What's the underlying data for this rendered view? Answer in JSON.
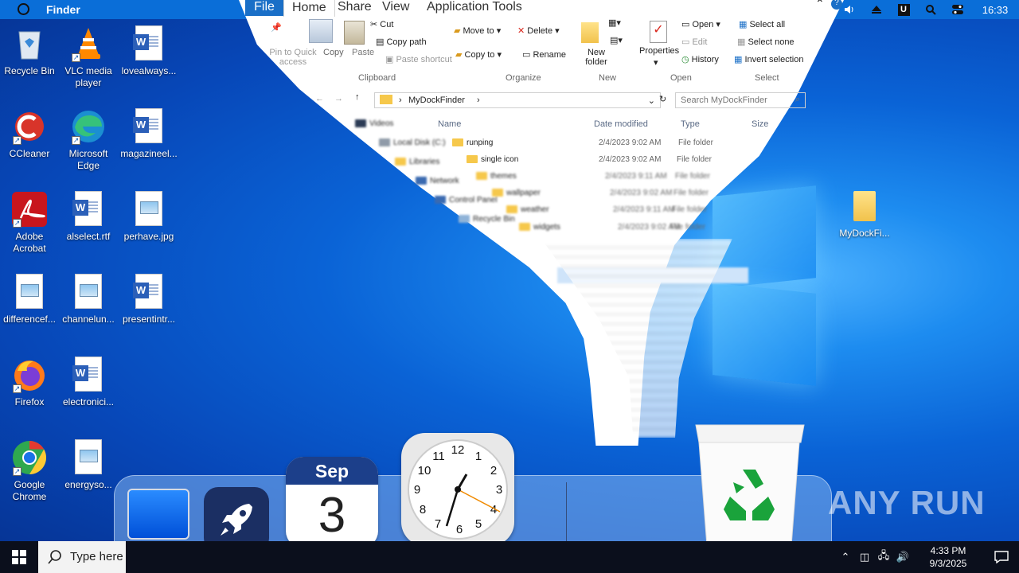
{
  "topbar": {
    "app_name": "Finder",
    "clock": "16:33",
    "u_badge": "U",
    "icons": [
      "apple-circle-icon",
      "volume-icon",
      "eject-icon",
      "u-badge-icon",
      "search-icon",
      "control-center-icon"
    ]
  },
  "desktop_icons": [
    {
      "label": "Recycle Bin",
      "icon": "recycle-bin-icon"
    },
    {
      "label": "VLC media player",
      "icon": "vlc-icon"
    },
    {
      "label": "lovealways...",
      "icon": "word-doc-icon"
    },
    {
      "label": "CCleaner",
      "icon": "ccleaner-icon"
    },
    {
      "label": "Microsoft Edge",
      "icon": "edge-icon"
    },
    {
      "label": "magazineel...",
      "icon": "word-doc-icon"
    },
    {
      "label": "Adobe Acrobat",
      "icon": "acrobat-icon"
    },
    {
      "label": "alselect.rtf",
      "icon": "word-doc-icon"
    },
    {
      "label": "perhave.jpg",
      "icon": "image-file-icon"
    },
    {
      "label": "differencef...",
      "icon": "image-file-icon"
    },
    {
      "label": "channelun...",
      "icon": "image-file-icon"
    },
    {
      "label": "presentintr...",
      "icon": "word-doc-icon"
    },
    {
      "label": "Firefox",
      "icon": "firefox-icon"
    },
    {
      "label": "electronici...",
      "icon": "word-doc-icon"
    },
    {
      "label": "Google Chrome",
      "icon": "chrome-icon"
    },
    {
      "label": "energyso...",
      "icon": "image-file-icon"
    },
    {
      "label": "MyDockFi...",
      "icon": "folder-icon"
    }
  ],
  "explorer": {
    "tabs": [
      "File",
      "Home",
      "Share",
      "View",
      "Application Tools"
    ],
    "clipboard": {
      "pin": "Pin to Quick access",
      "copy": "Copy",
      "paste": "Paste",
      "cut": "Cut",
      "copy_path": "Copy path",
      "paste_shortcut": "Paste shortcut",
      "label": "Clipboard"
    },
    "organize": {
      "move_to": "Move to",
      "copy_to": "Copy to",
      "delete": "Delete",
      "rename": "Rename",
      "label": "Organize"
    },
    "new": {
      "new_folder": "New folder",
      "label": "New"
    },
    "open": {
      "properties": "Properties",
      "open": "Open",
      "edit": "Edit",
      "history": "History",
      "label": "Open"
    },
    "select": {
      "select_all": "Select all",
      "select_none": "Select none",
      "invert": "Invert selection",
      "label": "Select"
    },
    "path": "MyDockFinder",
    "search_placeholder": "Search MyDockFinder",
    "columns": [
      "Name",
      "Date modified",
      "Type",
      "Size"
    ],
    "nav_pane": [
      "Videos",
      "Local Disk (C:)",
      "Libraries",
      "Network",
      "Control Panel",
      "Recycle Bin"
    ],
    "rows": [
      {
        "name": "runping",
        "date": "2/4/2023 9:02 AM",
        "type": "File folder"
      },
      {
        "name": "single icon",
        "date": "2/4/2023 9:02 AM",
        "type": "File folder"
      },
      {
        "name": "themes",
        "date": "2/4/2023 9:11 AM",
        "type": "File folder"
      },
      {
        "name": "wallpaper",
        "date": "2/4/2023 9:02 AM",
        "type": "File folder"
      },
      {
        "name": "weather",
        "date": "2/4/2023 9:11 AM",
        "type": "File folder"
      },
      {
        "name": "widgets",
        "date": "2/4/2023 9:02 AM",
        "type": "File folder"
      }
    ]
  },
  "dock": {
    "calendar_month": "Sep",
    "calendar_day": "3",
    "items": [
      "finder-monitor-icon",
      "launchpad-rocket-icon",
      "calendar-icon",
      "clock-icon",
      "trash-icon"
    ]
  },
  "taskbar": {
    "search_text": "Type here",
    "time": "4:33 PM",
    "date": "9/3/2025"
  },
  "watermark": "ANY RUN"
}
